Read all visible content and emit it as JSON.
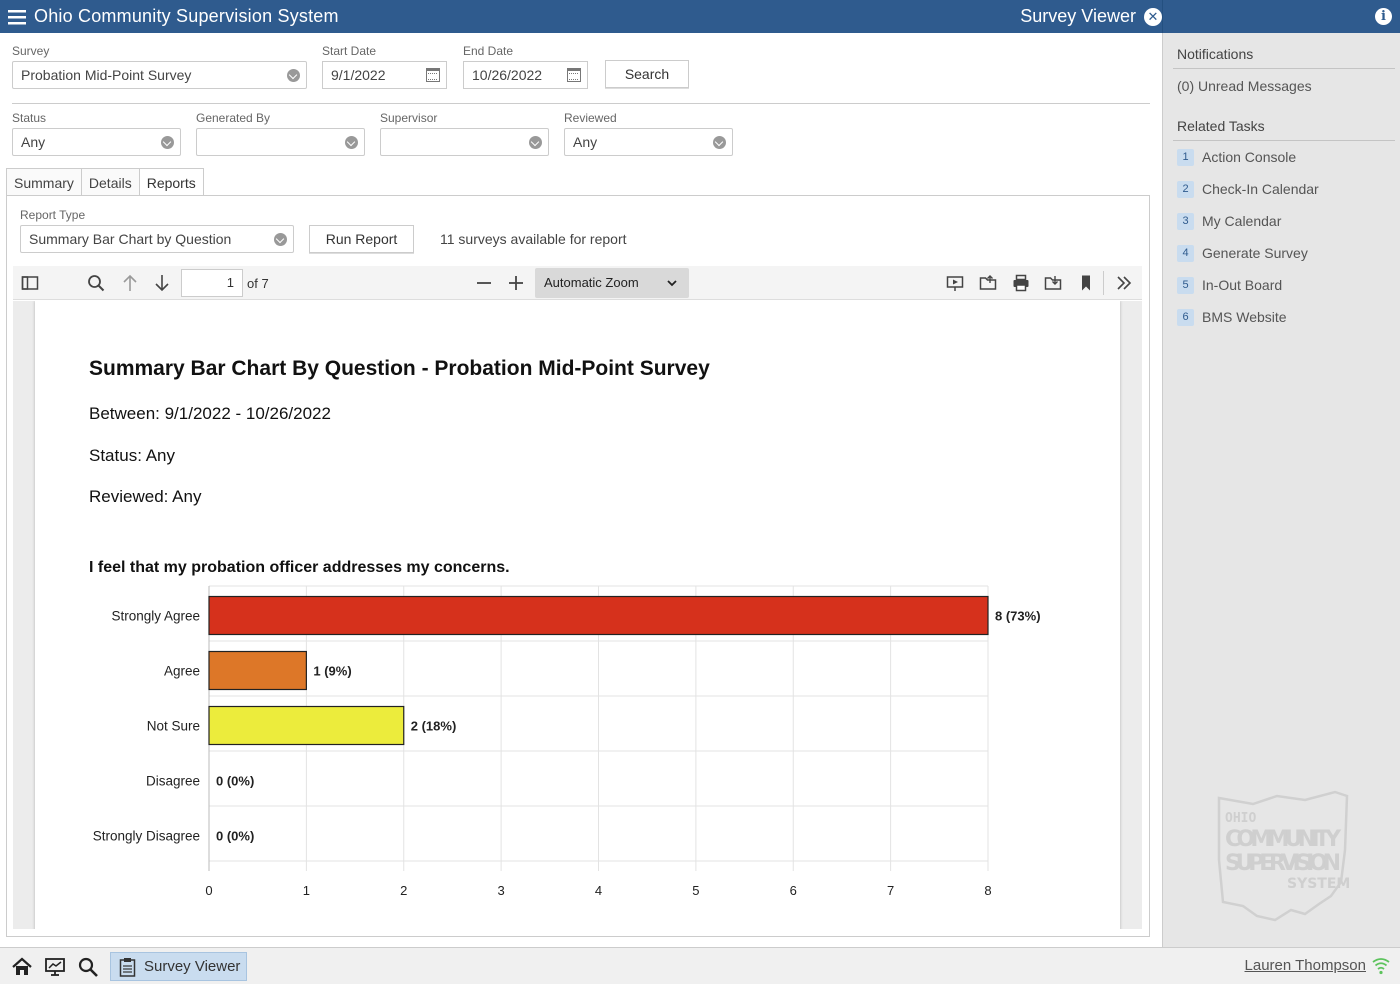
{
  "titlebar": {
    "app_title": "Ohio Community Supervision System",
    "view_title": "Survey Viewer"
  },
  "filters": {
    "survey_label": "Survey",
    "survey_value": "Probation Mid-Point Survey",
    "start_label": "Start Date",
    "start_value": "9/1/2022",
    "end_label": "End Date",
    "end_value": "10/26/2022",
    "search_label": "Search",
    "status_label": "Status",
    "status_value": "Any",
    "generated_label": "Generated By",
    "generated_value": "",
    "supervisor_label": "Supervisor",
    "supervisor_value": "",
    "reviewed_label": "Reviewed",
    "reviewed_value": "Any"
  },
  "tabs": [
    {
      "label": "Summary"
    },
    {
      "label": "Details"
    },
    {
      "label": "Reports"
    }
  ],
  "report": {
    "type_label": "Report Type",
    "type_value": "Summary Bar Chart by Question",
    "run_label": "Run Report",
    "available_text": "11 surveys available for report"
  },
  "pdf_toolbar": {
    "page": "1",
    "of_pages": "of 7",
    "zoom": "Automatic Zoom"
  },
  "document": {
    "title": "Summary Bar Chart By Question - Probation Mid-Point Survey",
    "between": "Between: 9/1/2022 - 10/26/2022",
    "status": "Status: Any",
    "reviewed": "Reviewed: Any",
    "question": "I feel that my probation officer addresses my concerns."
  },
  "chart_data": {
    "type": "bar",
    "orientation": "horizontal",
    "title": "I feel that my probation officer addresses my concerns.",
    "categories": [
      "Strongly Agree",
      "Agree",
      "Not Sure",
      "Disagree",
      "Strongly Disagree"
    ],
    "values": [
      8,
      1,
      2,
      0,
      0
    ],
    "labels": [
      "8 (73%)",
      "1 (9%)",
      "2 (18%)",
      "0 (0%)",
      "0 (0%)"
    ],
    "colors": [
      "#d6311c",
      "#dd7728",
      "#ecec3c",
      "#cccccc",
      "#cccccc"
    ],
    "xticks": [
      "0",
      "1",
      "2",
      "3",
      "4",
      "5",
      "6",
      "7",
      "8"
    ],
    "xlim": [
      0,
      8
    ],
    "grid": true
  },
  "sidebar": {
    "notifications_heading": "Notifications",
    "unread": "(0) Unread Messages",
    "tasks_heading": "Related Tasks",
    "tasks": [
      {
        "num": "1",
        "label": "Action Console"
      },
      {
        "num": "2",
        "label": "Check-In Calendar"
      },
      {
        "num": "3",
        "label": "My Calendar"
      },
      {
        "num": "4",
        "label": "Generate Survey"
      },
      {
        "num": "5",
        "label": "In-Out Board"
      },
      {
        "num": "6",
        "label": "BMS Website"
      }
    ],
    "logo_text": [
      "OHIO",
      "COMMUNITY",
      "SUPERVISION",
      "SYSTEM"
    ]
  },
  "bottombar": {
    "active_task": "Survey Viewer",
    "user": "Lauren Thompson"
  }
}
